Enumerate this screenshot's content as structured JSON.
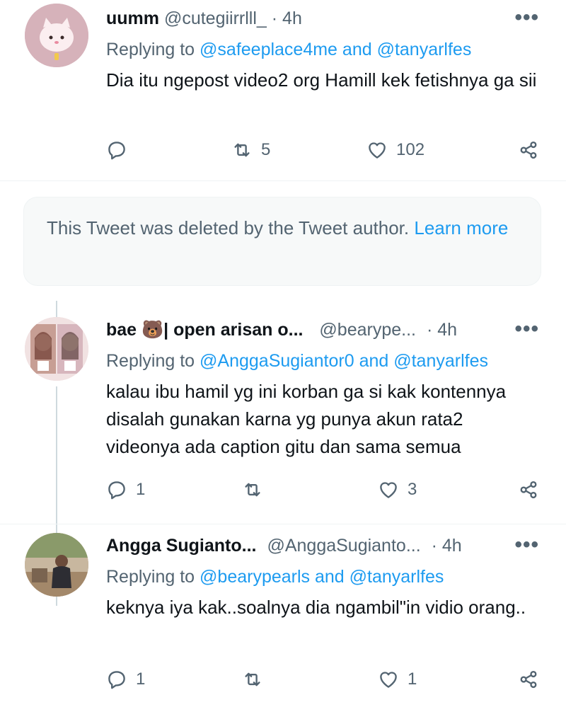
{
  "tweets": [
    {
      "name": "uumm",
      "handle": "@cutegiirrlll_",
      "time": "· 4h",
      "more": "•••",
      "replying_prefix": "Replying to ",
      "replying_links": "@safeeplace4me and @tanyarlfes",
      "text": "Dia itu ngepost video2 org Hamill kek fetishnya ga sii",
      "reply_count": "",
      "retweet_count": "5",
      "like_count": "102"
    },
    {
      "name": "bae 🐻| open arisan o...",
      "handle": "@bearype...",
      "time": "· 4h",
      "more": "•••",
      "replying_prefix": "Replying to ",
      "replying_links": "@AnggaSugiantor0 and @tanyarlfes",
      "text": "kalau ibu hamil yg ini korban ga si kak kontennya disalah gunakan karna yg punya akun rata2 videonya ada caption gitu dan sama semua",
      "reply_count": "1",
      "retweet_count": "",
      "like_count": "3"
    },
    {
      "name": "Angga Sugianto...",
      "handle": "@AnggaSugianto...",
      "time": "· 4h",
      "more": "•••",
      "replying_prefix": "Replying to ",
      "replying_links": "@bearypearls and @tanyarlfes",
      "text": "keknya iya kak..soalnya dia ngambil\"in vidio orang..",
      "reply_count": "1",
      "retweet_count": "",
      "like_count": "1"
    }
  ],
  "deleted_notice": {
    "text": "This Tweet was deleted by the Tweet author. ",
    "link": "Learn more"
  },
  "icons": {
    "reply": "reply-icon",
    "retweet": "retweet-icon",
    "like": "heart-icon",
    "share": "share-icon"
  },
  "colors": {
    "text": "#0f1419",
    "muted": "#536471",
    "link": "#1d9bf0"
  }
}
